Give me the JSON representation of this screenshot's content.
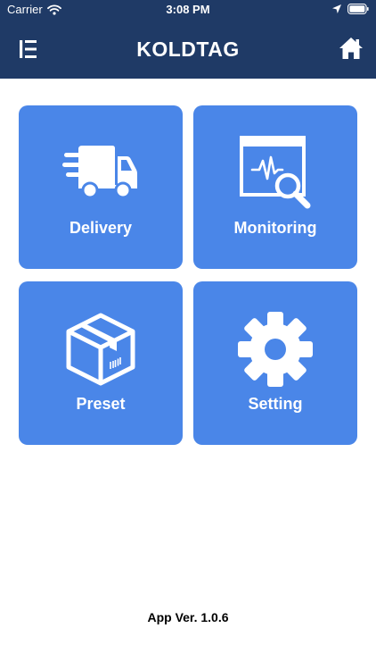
{
  "status_bar": {
    "carrier": "Carrier",
    "time": "3:08 PM"
  },
  "header": {
    "title": "KOLDTAG",
    "menu_icon": "menu-icon",
    "home_icon": "home-icon",
    "background": "#1f3a66"
  },
  "tiles": [
    {
      "label": "Delivery",
      "icon": "delivery-truck-icon"
    },
    {
      "label": "Monitoring",
      "icon": "monitoring-icon"
    },
    {
      "label": "Preset",
      "icon": "box-icon"
    },
    {
      "label": "Setting",
      "icon": "gear-icon"
    }
  ],
  "tile_color": "#4a86e8",
  "footer": {
    "version": "App Ver. 1.0.6"
  }
}
